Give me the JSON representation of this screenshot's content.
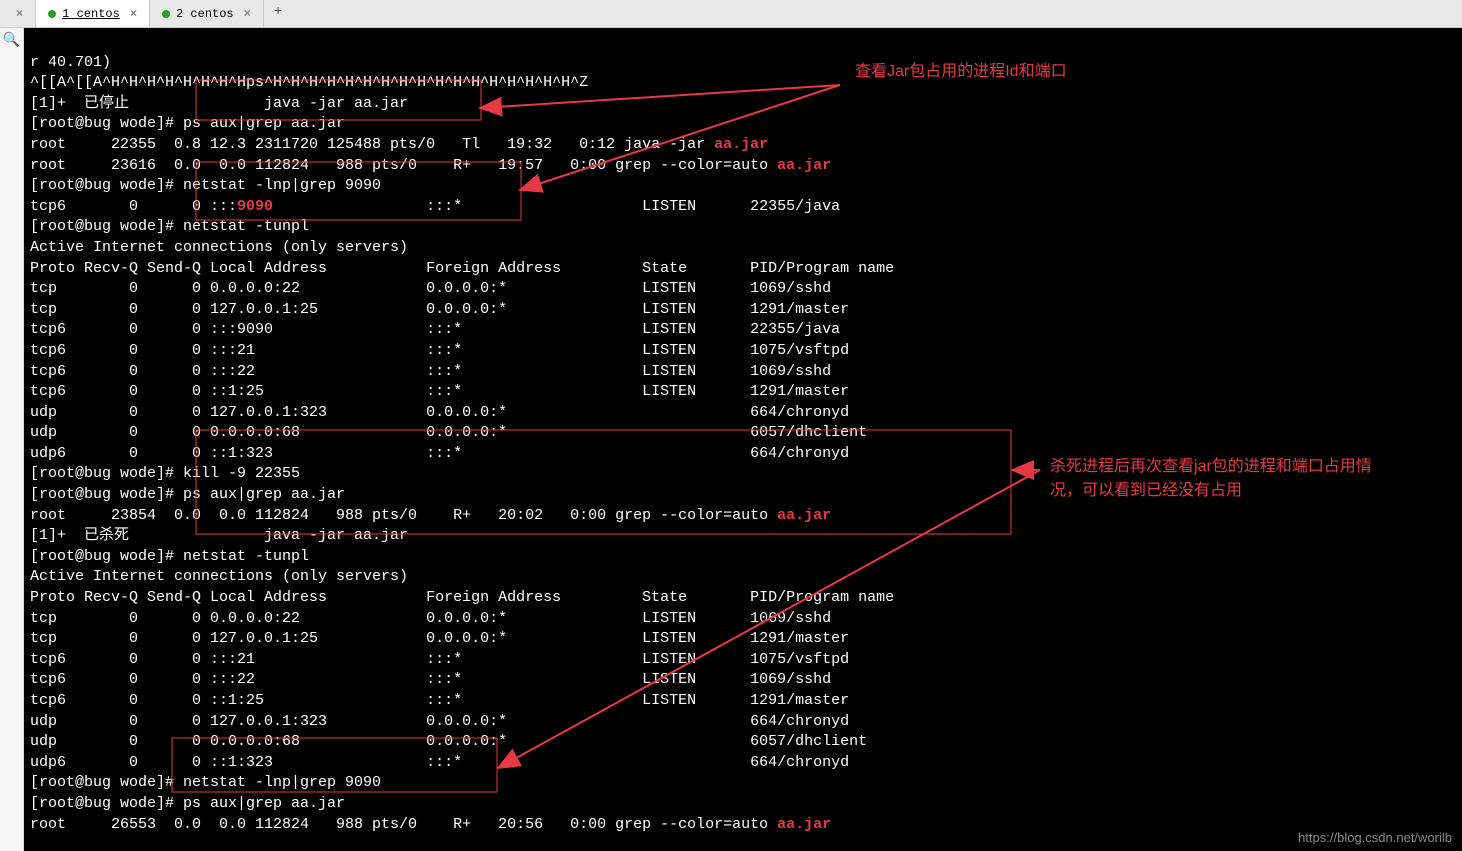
{
  "tabs": {
    "items": [
      {
        "label": "1 centos",
        "active": true
      },
      {
        "label": "2 centos",
        "active": false
      }
    ]
  },
  "side": {
    "search": "🔍"
  },
  "term": {
    "l1": "r 40.701)",
    "l2": "^[[A^[[A^H^H^H^H^H^H^H^Hps^H^H^H^H^H^H^H^H^H^H^H^H^H^H^H^H^H^Z",
    "l3": "[1]+  已停止               java -jar aa.jar",
    "prompt1": "[root@bug wode]# ",
    "cmd1": "ps aux|grep aa.jar",
    "ps1_a": "root     22355  0.8 12.3 2311720 125488 pts/0   Tl   19:32   0:12 java -jar ",
    "ps1_hl": "aa.jar",
    "ps2_a": "root     23616  0.0  0.0 112824   988 pts/0    R+   19:57   0:00 grep --color=auto ",
    "ps2_hl": "aa.jar",
    "cmd2": "netstat -lnp|grep 9090",
    "net1_a": "tcp6       0      0 :::",
    "net1_port": "9090",
    "net1_b": "                 :::*                    LISTEN      22355/java",
    "cmd3": "netstat -tunpl",
    "active_conn": "Active Internet connections (only servers)",
    "hdr": "Proto Recv-Q Send-Q Local Address           Foreign Address         State       PID/Program name",
    "t1_r1": "tcp        0      0 0.0.0.0:22              0.0.0.0:*               LISTEN      1069/sshd",
    "t1_r2": "tcp        0      0 127.0.0.1:25            0.0.0.0:*               LISTEN      1291/master",
    "t1_r3": "tcp6       0      0 :::9090                 :::*                    LISTEN      22355/java",
    "t1_r4": "tcp6       0      0 :::21                   :::*                    LISTEN      1075/vsftpd",
    "t1_r5": "tcp6       0      0 :::22                   :::*                    LISTEN      1069/sshd",
    "t1_r6": "tcp6       0      0 ::1:25                  :::*                    LISTEN      1291/master",
    "t1_r7": "udp        0      0 127.0.0.1:323           0.0.0.0:*                           664/chronyd",
    "t1_r8": "udp        0      0 0.0.0.0:68              0.0.0.0:*                           6057/dhclient",
    "t1_r9": "udp6       0      0 ::1:323                 :::*                                664/chronyd",
    "cmd4": "kill -9 22355",
    "cmd5": "ps aux|grep aa.jar",
    "ps3_a": "root     23854  0.0  0.0 112824   988 pts/0    R+   20:02   0:00 grep --color=auto ",
    "ps3_hl": "aa.jar",
    "killed": "[1]+  已杀死               java -jar aa.jar",
    "cmd6": "netstat -tunpl",
    "t2_r1": "tcp        0      0 0.0.0.0:22              0.0.0.0:*               LISTEN      1069/sshd",
    "t2_r2": "tcp        0      0 127.0.0.1:25            0.0.0.0:*               LISTEN      1291/master",
    "t2_r3": "tcp6       0      0 :::21                   :::*                    LISTEN      1075/vsftpd",
    "t2_r4": "tcp6       0      0 :::22                   :::*                    LISTEN      1069/sshd",
    "t2_r5": "tcp6       0      0 ::1:25                  :::*                    LISTEN      1291/master",
    "t2_r6": "udp        0      0 127.0.0.1:323           0.0.0.0:*                           664/chronyd",
    "t2_r7": "udp        0      0 0.0.0.0:68              0.0.0.0:*                           6057/dhclient",
    "t2_r8": "udp6       0      0 ::1:323                 :::*                                664/chronyd",
    "cmd7": "netstat -lnp|grep 9090",
    "cmd8": "ps aux|grep aa.jar",
    "ps4_a": "root     26553  0.0  0.0 112824   988 pts/0    R+   20:56   0:00 grep --color=auto ",
    "ps4_hl": "aa.jar"
  },
  "annotations": {
    "a1": "查看Jar包占用的进程Id和端口",
    "a2": "杀死进程后再次查看jar包的进程和端口占用情况，可以看到已经没有占用"
  },
  "watermark": "https://blog.csdn.net/worilb"
}
